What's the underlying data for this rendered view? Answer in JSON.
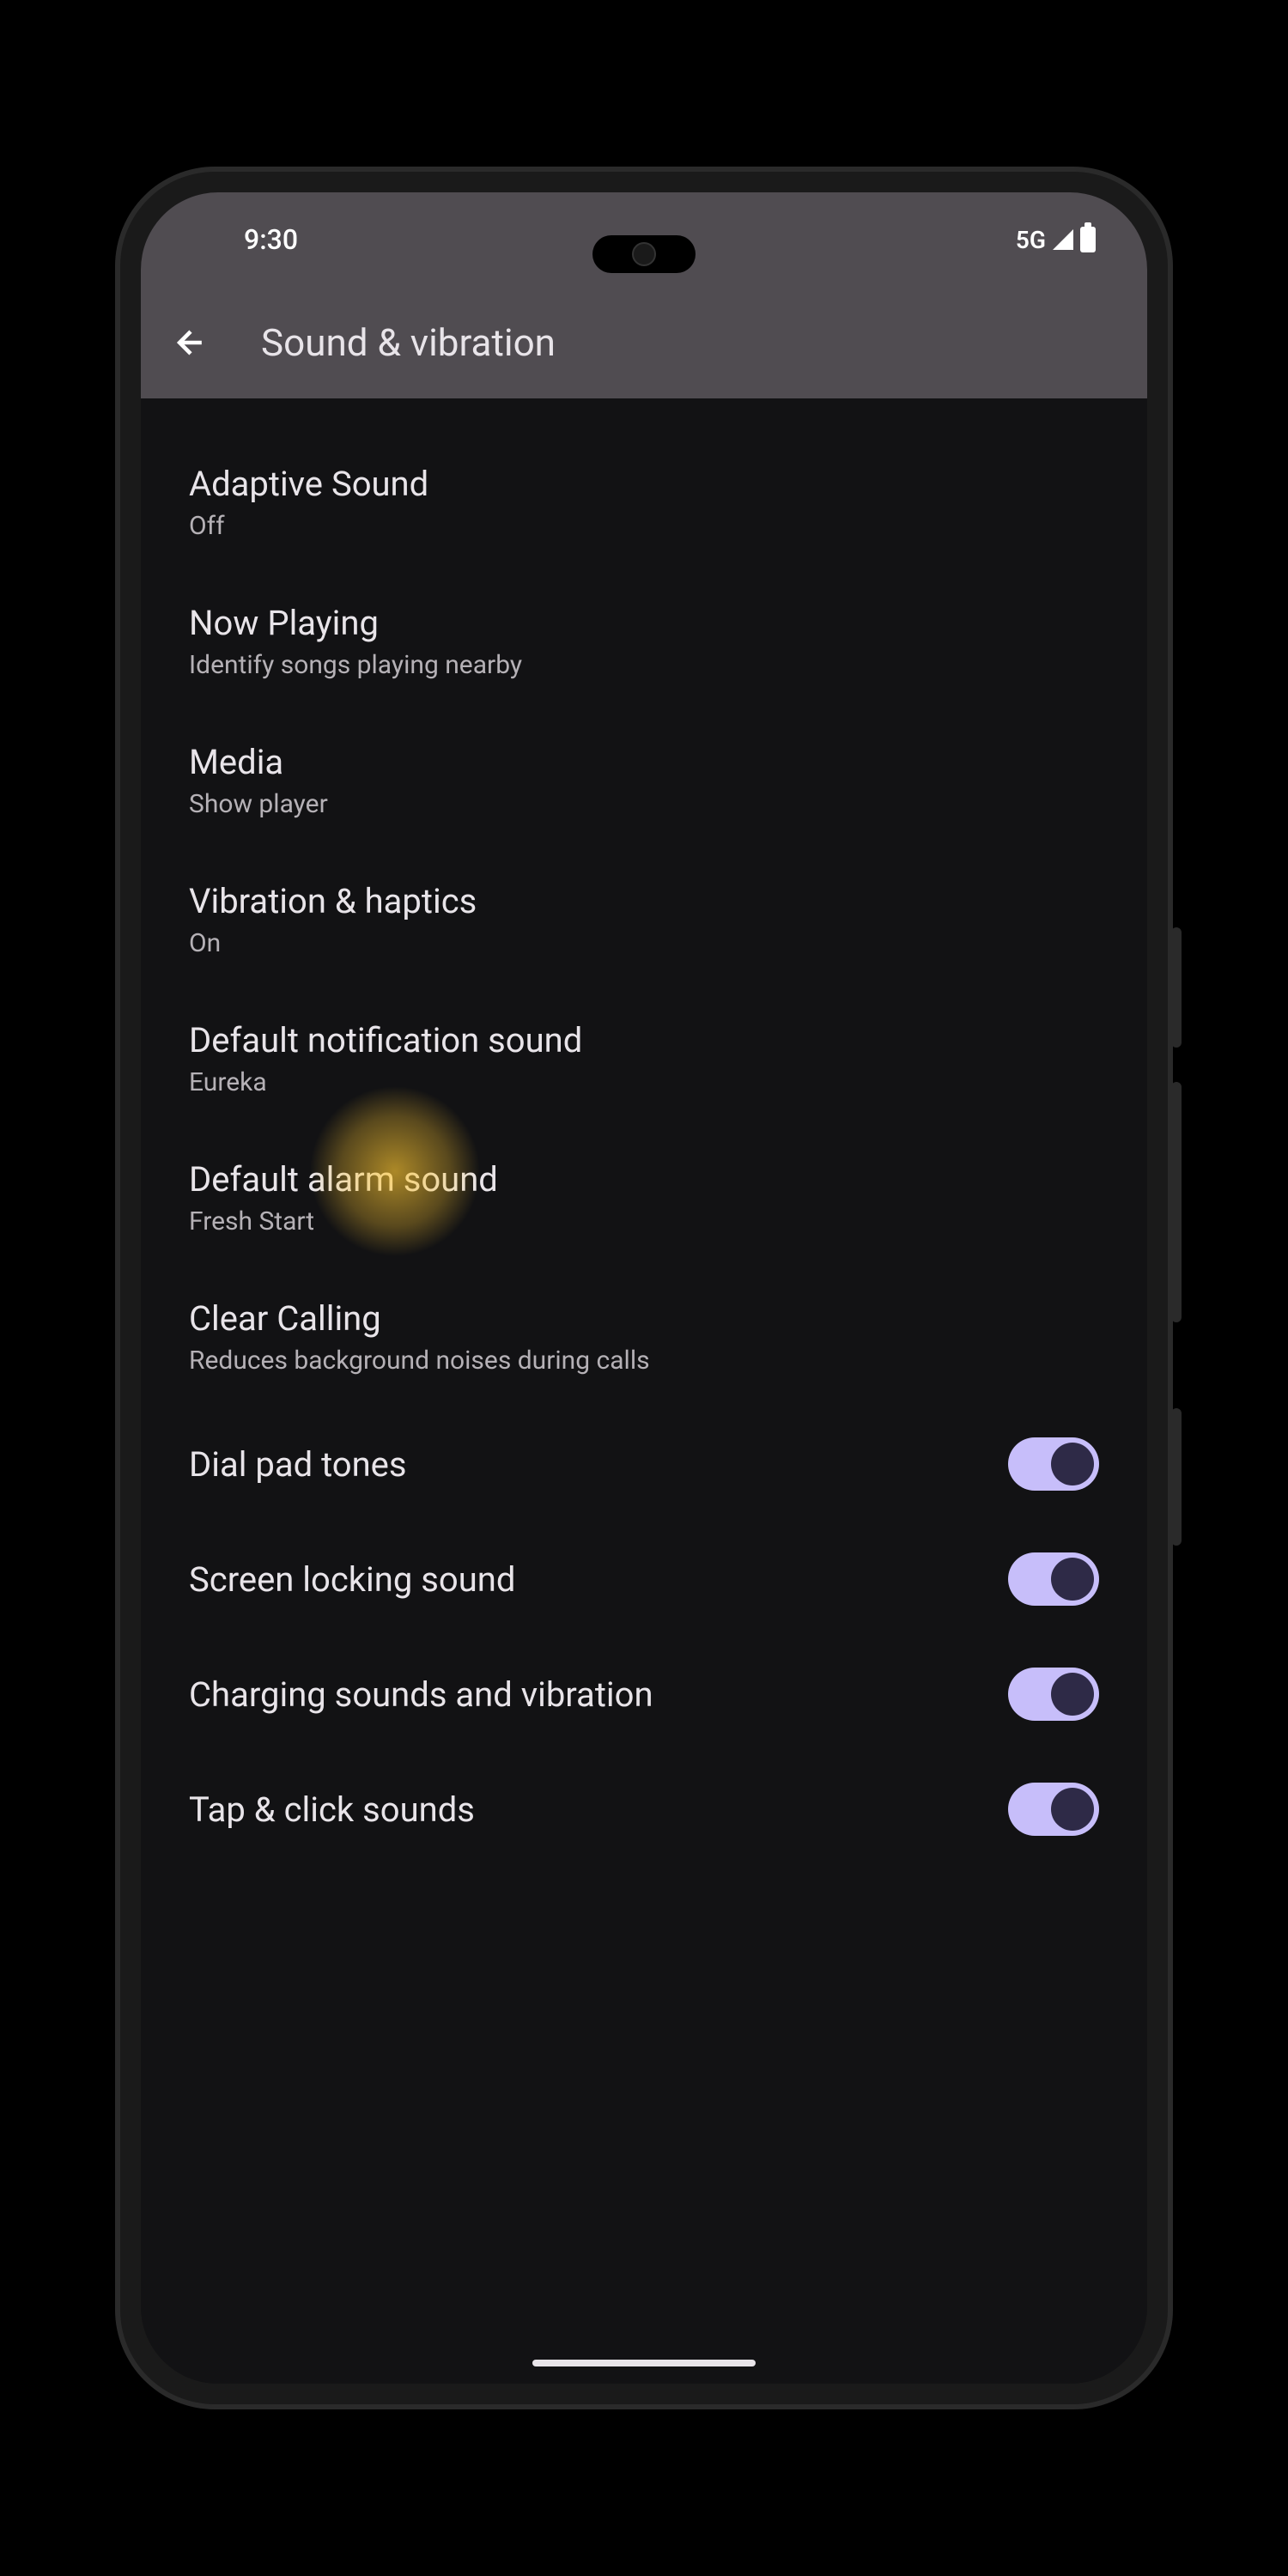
{
  "status_bar": {
    "time": "9:30",
    "network": "5G"
  },
  "app_bar": {
    "title": "Sound & vibration"
  },
  "settings": {
    "adaptive_sound": {
      "title": "Adaptive Sound",
      "subtitle": "Off"
    },
    "now_playing": {
      "title": "Now Playing",
      "subtitle": "Identify songs playing nearby"
    },
    "media": {
      "title": "Media",
      "subtitle": "Show player"
    },
    "vibration_haptics": {
      "title": "Vibration & haptics",
      "subtitle": "On"
    },
    "default_notification": {
      "title": "Default notification sound",
      "subtitle": "Eureka"
    },
    "default_alarm": {
      "title": "Default alarm sound",
      "subtitle": "Fresh Start"
    },
    "clear_calling": {
      "title": "Clear Calling",
      "subtitle": "Reduces background noises during calls"
    },
    "dial_pad_tones": {
      "title": "Dial pad tones",
      "toggled": true
    },
    "screen_locking": {
      "title": "Screen locking sound",
      "toggled": true
    },
    "charging_sounds": {
      "title": "Charging sounds and vibration",
      "toggled": true
    },
    "tap_click": {
      "title": "Tap & click sounds",
      "toggled": true
    }
  },
  "colors": {
    "accent": "#c7befa",
    "bg_dark": "#121214",
    "bg_header": "#504c51"
  }
}
